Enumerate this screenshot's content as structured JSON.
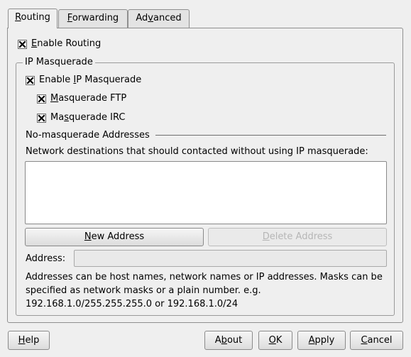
{
  "tabs": [
    {
      "label": "Routing",
      "mnemonic_index": 0,
      "active": true
    },
    {
      "label": "Forwarding",
      "mnemonic_index": 0,
      "active": false
    },
    {
      "label": "Advanced",
      "mnemonic_index": 2,
      "active": false
    }
  ],
  "routing": {
    "enable_routing": {
      "label": "Enable Routing",
      "mnemonic_index": 0,
      "checked": true
    },
    "ip_masquerade": {
      "legend": "IP Masquerade",
      "enable": {
        "label": "Enable IP Masquerade",
        "mnemonic_index": 7,
        "checked": true
      },
      "ftp": {
        "label": "Masquerade FTP",
        "mnemonic_index": 0,
        "checked": true
      },
      "irc": {
        "label": "Masquerade IRC",
        "mnemonic_index": 2,
        "checked": true
      }
    },
    "no_masq": {
      "title": "No-masquerade Addresses",
      "description": "Network destinations that should contacted without using IP masquerade:",
      "new_button": {
        "label": "New Address",
        "mnemonic_index": 0
      },
      "delete_button": {
        "label": "Delete Address",
        "mnemonic_index": 0,
        "enabled": false
      },
      "address_label": "Address:",
      "address_value": "",
      "help_text": "Addresses can be host names, network names or IP addresses. Masks can be specified as network masks or a plain number. e.g. 192.168.1.0/255.255.255.0 or 192.168.1.0/24"
    }
  },
  "footer": {
    "help": {
      "label": "Help",
      "mnemonic_index": 0
    },
    "about": {
      "label": "About",
      "mnemonic_index": 1
    },
    "ok": {
      "label": "OK",
      "mnemonic_index": 0
    },
    "apply": {
      "label": "Apply",
      "mnemonic_index": 0
    },
    "cancel": {
      "label": "Cancel",
      "mnemonic_index": 0
    }
  }
}
